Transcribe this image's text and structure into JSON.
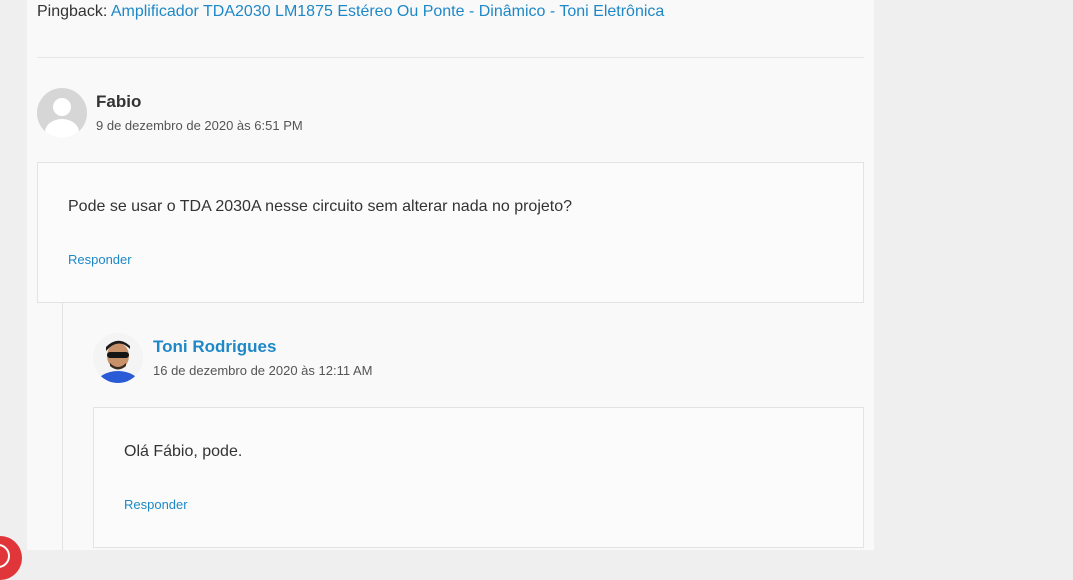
{
  "pingback": {
    "prefix": "Pingback:",
    "link_text": "Amplificador TDA2030 LM1875 Estéreo Ou Ponte - Dinâmico - Toni Eletrônica"
  },
  "comments": [
    {
      "author": "Fabio",
      "date": "9 de dezembro de 2020 às 6:51 PM",
      "text": "Pode se usar o TDA 2030A nesse circuito sem alterar nada no projeto?",
      "reply_label": "Responder",
      "avatar": "default-user-avatar"
    },
    {
      "author": "Toni Rodrigues",
      "date": "16 de dezembro de 2020 às 12:11 AM",
      "text": "Olá Fábio, pode.",
      "reply_label": "Responder",
      "avatar": "profile-photo"
    }
  ],
  "colors": {
    "link": "#1e88c7",
    "page_bg": "#efefef",
    "content_bg": "#f9f9f9",
    "badge": "#e0363a"
  }
}
